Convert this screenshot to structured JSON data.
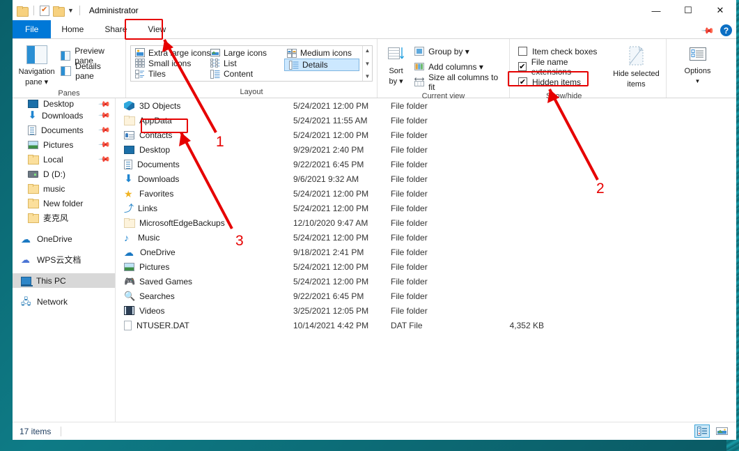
{
  "window": {
    "title": "Administrator",
    "quick_access": [
      "folder-icon",
      "properties-icon",
      "new-folder-icon",
      "customize-caret"
    ],
    "controls": {
      "minimize": "—",
      "maximize": "☐",
      "close": "✕"
    }
  },
  "tabs": [
    {
      "label": "File",
      "id": "file",
      "active": false
    },
    {
      "label": "Home",
      "id": "home",
      "active": false
    },
    {
      "label": "Share",
      "id": "share",
      "active": false
    },
    {
      "label": "View",
      "id": "view",
      "active": true
    }
  ],
  "ribbon": {
    "panes_group": {
      "title": "Panes",
      "navigation_pane": "Navigation\npane",
      "navigation_pane_line1": "Navigation",
      "navigation_pane_line2": "pane",
      "preview_pane": "Preview pane",
      "details_pane": "Details pane"
    },
    "layout_group": {
      "title": "Layout",
      "items": [
        {
          "label": "Extra large icons",
          "selected": false
        },
        {
          "label": "Large icons",
          "selected": false
        },
        {
          "label": "Medium icons",
          "selected": false
        },
        {
          "label": "Small icons",
          "selected": false
        },
        {
          "label": "List",
          "selected": false
        },
        {
          "label": "Details",
          "selected": true
        },
        {
          "label": "Tiles",
          "selected": false
        },
        {
          "label": "Content",
          "selected": false
        }
      ]
    },
    "current_view_group": {
      "title": "Current view",
      "sort_by_line1": "Sort",
      "sort_by_line2": "by",
      "group_by": "Group by",
      "add_columns": "Add columns",
      "size_all_columns": "Size all columns to fit"
    },
    "show_hide_group": {
      "title": "Show/hide",
      "checkboxes": [
        {
          "label": "Item check boxes",
          "checked": false
        },
        {
          "label": "File name extensions",
          "checked": true
        },
        {
          "label": "Hidden items",
          "checked": true
        }
      ],
      "hide_selected_line1": "Hide selected",
      "hide_selected_line2": "items"
    },
    "options_group": {
      "label": "Options"
    }
  },
  "navigation_pane": {
    "items": [
      {
        "label": "Desktop",
        "icon": "desktop-icon",
        "pinned": true,
        "indent": true,
        "selected": false
      },
      {
        "label": "Downloads",
        "icon": "downloads-icon",
        "pinned": true,
        "indent": true,
        "selected": false
      },
      {
        "label": "Documents",
        "icon": "documents-icon",
        "pinned": true,
        "indent": true,
        "selected": false
      },
      {
        "label": "Pictures",
        "icon": "pictures-icon",
        "pinned": true,
        "indent": true,
        "selected": false
      },
      {
        "label": "Local",
        "icon": "folder-icon",
        "pinned": true,
        "indent": true,
        "selected": false
      },
      {
        "label": "D (D:)",
        "icon": "drive-icon",
        "pinned": false,
        "indent": true,
        "selected": false
      },
      {
        "label": "music",
        "icon": "folder-icon",
        "pinned": false,
        "indent": true,
        "selected": false
      },
      {
        "label": "New folder",
        "icon": "folder-icon",
        "pinned": false,
        "indent": true,
        "selected": false
      },
      {
        "label": "麦克风",
        "icon": "folder-icon",
        "pinned": false,
        "indent": true,
        "selected": false
      },
      {
        "label": "OneDrive",
        "icon": "onedrive-icon",
        "pinned": false,
        "indent": false,
        "selected": false
      },
      {
        "label": "WPS云文档",
        "icon": "wps-cloud-icon",
        "pinned": false,
        "indent": false,
        "selected": false
      },
      {
        "label": "This PC",
        "icon": "this-pc-icon",
        "pinned": false,
        "indent": false,
        "selected": true
      },
      {
        "label": "Network",
        "icon": "network-icon",
        "pinned": false,
        "indent": false,
        "selected": false
      }
    ]
  },
  "file_list": {
    "rows": [
      {
        "name": "3D Objects",
        "icon": "3d-objects-icon",
        "date": "5/24/2021 12:00 PM",
        "type": "File folder",
        "size": ""
      },
      {
        "name": "AppData",
        "icon": "folder-hidden-icon",
        "date": "5/24/2021 11:55 AM",
        "type": "File folder",
        "size": ""
      },
      {
        "name": "Contacts",
        "icon": "contacts-icon",
        "date": "5/24/2021 12:00 PM",
        "type": "File folder",
        "size": ""
      },
      {
        "name": "Desktop",
        "icon": "desktop-icon",
        "date": "9/29/2021 2:40 PM",
        "type": "File folder",
        "size": ""
      },
      {
        "name": "Documents",
        "icon": "documents-icon",
        "date": "9/22/2021 6:45 PM",
        "type": "File folder",
        "size": ""
      },
      {
        "name": "Downloads",
        "icon": "downloads-icon",
        "date": "9/6/2021 9:32 AM",
        "type": "File folder",
        "size": ""
      },
      {
        "name": "Favorites",
        "icon": "favorites-icon",
        "date": "5/24/2021 12:00 PM",
        "type": "File folder",
        "size": ""
      },
      {
        "name": "Links",
        "icon": "links-icon",
        "date": "5/24/2021 12:00 PM",
        "type": "File folder",
        "size": ""
      },
      {
        "name": "MicrosoftEdgeBackups",
        "icon": "folder-icon",
        "date": "12/10/2020 9:47 AM",
        "type": "File folder",
        "size": ""
      },
      {
        "name": "Music",
        "icon": "music-icon",
        "date": "5/24/2021 12:00 PM",
        "type": "File folder",
        "size": ""
      },
      {
        "name": "OneDrive",
        "icon": "onedrive-icon",
        "date": "9/18/2021 2:41 PM",
        "type": "File folder",
        "size": ""
      },
      {
        "name": "Pictures",
        "icon": "pictures-icon",
        "date": "5/24/2021 12:00 PM",
        "type": "File folder",
        "size": ""
      },
      {
        "name": "Saved Games",
        "icon": "saved-games-icon",
        "date": "5/24/2021 12:00 PM",
        "type": "File folder",
        "size": ""
      },
      {
        "name": "Searches",
        "icon": "searches-icon",
        "date": "9/22/2021 6:45 PM",
        "type": "File folder",
        "size": ""
      },
      {
        "name": "Videos",
        "icon": "videos-icon",
        "date": "3/25/2021 12:05 PM",
        "type": "File folder",
        "size": ""
      },
      {
        "name": "NTUSER.DAT",
        "icon": "dat-file-icon",
        "date": "10/14/2021 4:42 PM",
        "type": "DAT File",
        "size": "4,352 KB"
      }
    ]
  },
  "status_bar": {
    "item_count": "17 items",
    "view_toggle_details": "details-view-icon",
    "view_toggle_thumbnails": "large-icons-view-icon"
  },
  "annotations": {
    "color": "#e60000",
    "markers": [
      {
        "label": "1",
        "points_to": "View tab"
      },
      {
        "label": "2",
        "points_to": "Hidden items checkbox"
      },
      {
        "label": "3",
        "points_to": "AppData folder"
      }
    ],
    "boxes": [
      {
        "target": "View tab"
      },
      {
        "target": "Hidden items checkbox"
      },
      {
        "target": "AppData file name"
      }
    ]
  }
}
